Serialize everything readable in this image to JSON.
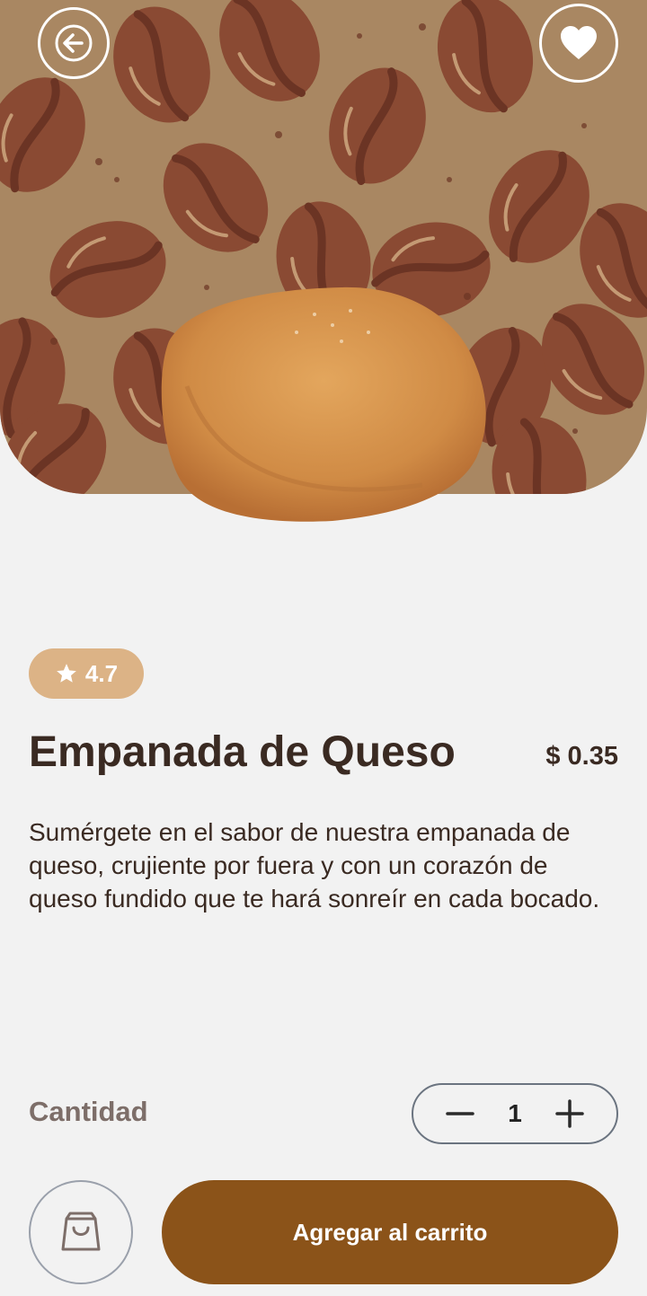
{
  "header": {
    "back_icon": "arrow-left-icon",
    "favorite_icon": "heart-icon"
  },
  "hero": {
    "background_color": "#a98762",
    "bean_color": "#8a4a33"
  },
  "product": {
    "rating": "4.7",
    "name": "Empanada de Queso",
    "price": "$ 0.35",
    "description": "Sumérgete en el sabor de nuestra empanada de queso, crujiente por fuera y con un corazón de queso fundido que te hará sonreír en cada bocado."
  },
  "quantity": {
    "label": "Cantidad",
    "value": "1"
  },
  "actions": {
    "add_to_cart_label": "Agregar al carrito",
    "accent_color": "#8b5319"
  }
}
